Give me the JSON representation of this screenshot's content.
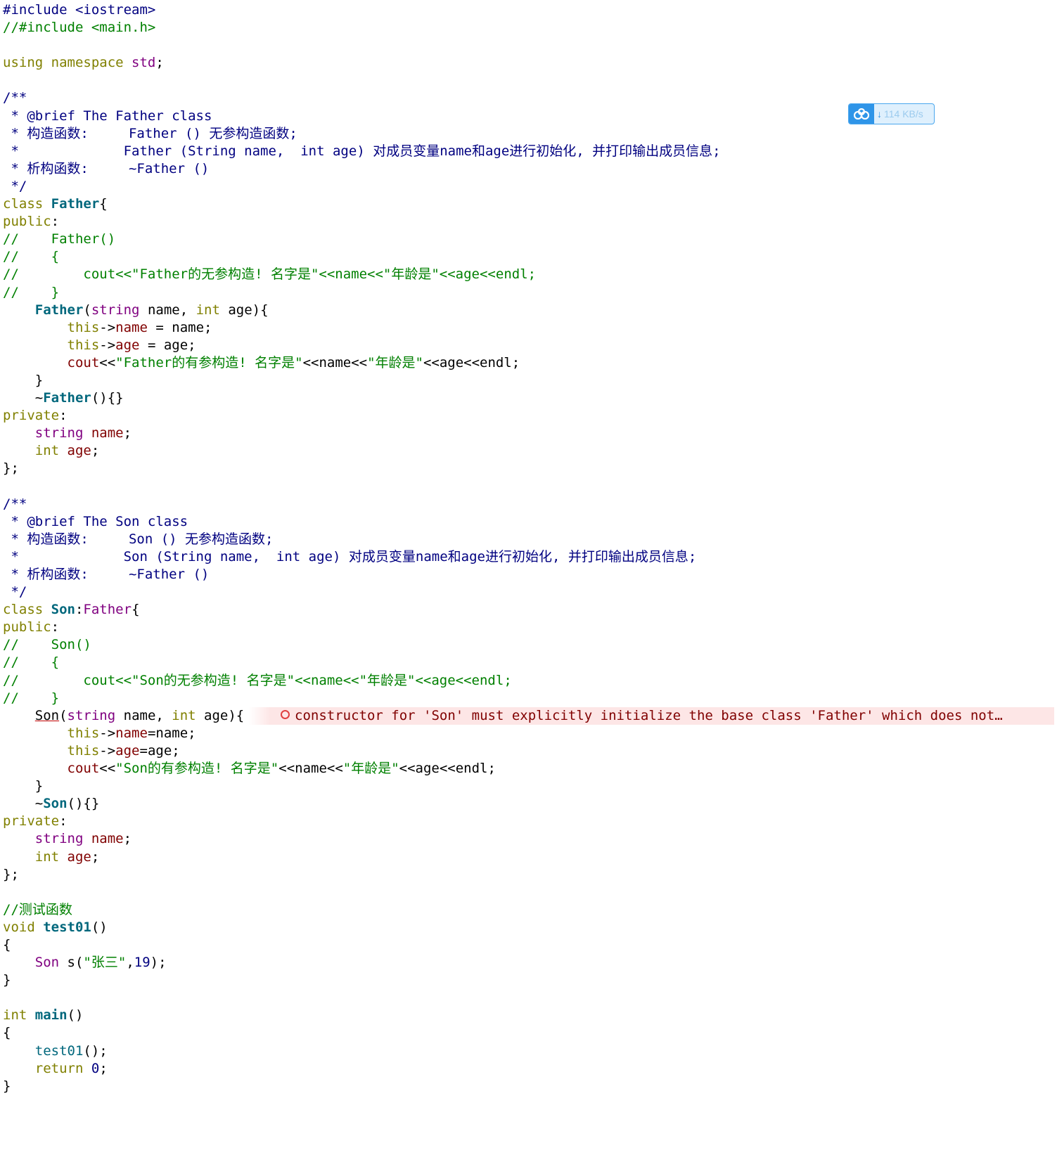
{
  "lines": [
    [
      [
        "pp",
        "#include <iostream>"
      ]
    ],
    [
      [
        "c",
        "//#include <main.h>"
      ]
    ],
    [],
    [
      [
        "k",
        "using namespace "
      ],
      [
        "pk",
        "std"
      ],
      [
        "p",
        ";"
      ]
    ],
    [],
    [
      [
        "d",
        "/**"
      ]
    ],
    [
      [
        "d",
        " * @brief The Father class"
      ]
    ],
    [
      [
        "d",
        " * 构造函数:     Father () 无参构造函数;"
      ]
    ],
    [
      [
        "d",
        " *             Father (String name,  int age) 对成员变量name和age进行初始化, 并打印输出成员信息;"
      ]
    ],
    [
      [
        "d",
        " * 析构函数:     ~Father ()"
      ]
    ],
    [
      [
        "d",
        " */"
      ]
    ],
    [
      [
        "k",
        "class "
      ],
      [
        "fb",
        "Father"
      ],
      [
        "p",
        "{"
      ]
    ],
    [
      [
        "k",
        "public"
      ],
      [
        "p",
        ":"
      ]
    ],
    [
      [
        "c",
        "//    Father()"
      ]
    ],
    [
      [
        "c",
        "//    {"
      ]
    ],
    [
      [
        "c",
        "//        cout<<\"Father的无参构造! 名字是\"<<name<<\"年龄是\"<<age<<endl;"
      ]
    ],
    [
      [
        "c",
        "//    }"
      ]
    ],
    [
      [
        "p",
        "    "
      ],
      [
        "fb",
        "Father"
      ],
      [
        "p",
        "("
      ],
      [
        "t",
        "string"
      ],
      [
        "p",
        " name, "
      ],
      [
        "k",
        "int"
      ],
      [
        "p",
        " age){"
      ]
    ],
    [
      [
        "p",
        "        "
      ],
      [
        "k",
        "this"
      ],
      [
        "p",
        "->"
      ],
      [
        "v",
        "name"
      ],
      [
        "p",
        " = name;"
      ]
    ],
    [
      [
        "p",
        "        "
      ],
      [
        "k",
        "this"
      ],
      [
        "p",
        "->"
      ],
      [
        "v",
        "age"
      ],
      [
        "p",
        " = age;"
      ]
    ],
    [
      [
        "p",
        "        "
      ],
      [
        "v",
        "cout"
      ],
      [
        "p",
        "<<"
      ],
      [
        "s",
        "\"Father的有参构造! 名字是\""
      ],
      [
        "p",
        "<<name<<"
      ],
      [
        "s",
        "\"年龄是\""
      ],
      [
        "p",
        "<<age<<endl;"
      ]
    ],
    [
      [
        "p",
        "    }"
      ]
    ],
    [
      [
        "p",
        "    ~"
      ],
      [
        "fb",
        "Father"
      ],
      [
        "p",
        "(){}"
      ]
    ],
    [
      [
        "k",
        "private"
      ],
      [
        "p",
        ":"
      ]
    ],
    [
      [
        "p",
        "    "
      ],
      [
        "t",
        "string"
      ],
      [
        "p",
        " "
      ],
      [
        "v",
        "name"
      ],
      [
        "p",
        ";"
      ]
    ],
    [
      [
        "p",
        "    "
      ],
      [
        "k",
        "int"
      ],
      [
        "p",
        " "
      ],
      [
        "v",
        "age"
      ],
      [
        "p",
        ";"
      ]
    ],
    [
      [
        "p",
        "};"
      ]
    ],
    [],
    [
      [
        "d",
        "/**"
      ]
    ],
    [
      [
        "d",
        " * @brief The Son class"
      ]
    ],
    [
      [
        "d",
        " * 构造函数:     Son () 无参构造函数;"
      ]
    ],
    [
      [
        "d",
        " *             Son (String name,  int age) 对成员变量name和age进行初始化, 并打印输出成员信息;"
      ]
    ],
    [
      [
        "d",
        " * 析构函数:     ~Father ()"
      ]
    ],
    [
      [
        "d",
        " */"
      ]
    ],
    [
      [
        "k",
        "class "
      ],
      [
        "fb",
        "Son"
      ],
      [
        "p",
        ":"
      ],
      [
        "t",
        "Father"
      ],
      [
        "p",
        "{"
      ]
    ],
    [
      [
        "k",
        "public"
      ],
      [
        "p",
        ":"
      ]
    ],
    [
      [
        "c",
        "//    Son()"
      ]
    ],
    [
      [
        "c",
        "//    {"
      ]
    ],
    [
      [
        "c",
        "//        cout<<\"Son的无参构造! 名字是\"<<name<<\"年龄是\"<<age<<endl;"
      ]
    ],
    [
      [
        "c",
        "//    }"
      ]
    ],
    [
      [
        "p",
        "    "
      ],
      [
        "e",
        "Son"
      ],
      [
        "p",
        "("
      ],
      [
        "t",
        "string"
      ],
      [
        "p",
        " name, "
      ],
      [
        "k",
        "int"
      ],
      [
        "p",
        " age){"
      ]
    ],
    [
      [
        "p",
        "        "
      ],
      [
        "k",
        "this"
      ],
      [
        "p",
        "->"
      ],
      [
        "v",
        "name"
      ],
      [
        "p",
        "=name;"
      ]
    ],
    [
      [
        "p",
        "        "
      ],
      [
        "k",
        "this"
      ],
      [
        "p",
        "->"
      ],
      [
        "v",
        "age"
      ],
      [
        "p",
        "=age;"
      ]
    ],
    [
      [
        "p",
        "        "
      ],
      [
        "v",
        "cout"
      ],
      [
        "p",
        "<<"
      ],
      [
        "s",
        "\"Son的有参构造! 名字是\""
      ],
      [
        "p",
        "<<name<<"
      ],
      [
        "s",
        "\"年龄是\""
      ],
      [
        "p",
        "<<age<<endl;"
      ]
    ],
    [
      [
        "p",
        "    }"
      ]
    ],
    [
      [
        "p",
        "    ~"
      ],
      [
        "fb",
        "Son"
      ],
      [
        "p",
        "(){}"
      ]
    ],
    [
      [
        "k",
        "private"
      ],
      [
        "p",
        ":"
      ]
    ],
    [
      [
        "p",
        "    "
      ],
      [
        "t",
        "string"
      ],
      [
        "p",
        " "
      ],
      [
        "v",
        "name"
      ],
      [
        "p",
        ";"
      ]
    ],
    [
      [
        "p",
        "    "
      ],
      [
        "k",
        "int"
      ],
      [
        "p",
        " "
      ],
      [
        "v",
        "age"
      ],
      [
        "p",
        ";"
      ]
    ],
    [
      [
        "p",
        "};"
      ]
    ],
    [],
    [
      [
        "c",
        "//测试函数"
      ]
    ],
    [
      [
        "k",
        "void "
      ],
      [
        "fb",
        "test01"
      ],
      [
        "p",
        "()"
      ]
    ],
    [
      [
        "p",
        "{"
      ]
    ],
    [
      [
        "p",
        "    "
      ],
      [
        "t",
        "Son"
      ],
      [
        "p",
        " s("
      ],
      [
        "s",
        "\"张三\""
      ],
      [
        "p",
        ","
      ],
      [
        "n",
        "19"
      ],
      [
        "p",
        ");"
      ]
    ],
    [
      [
        "p",
        "}"
      ]
    ],
    [],
    [
      [
        "k",
        "int "
      ],
      [
        "fb",
        "main"
      ],
      [
        "p",
        "()"
      ]
    ],
    [
      [
        "p",
        "{"
      ]
    ],
    [
      [
        "p",
        "    "
      ],
      [
        "f",
        "test01"
      ],
      [
        "p",
        "();"
      ]
    ],
    [
      [
        "p",
        "    "
      ],
      [
        "k",
        "return"
      ],
      [
        "p",
        " "
      ],
      [
        "n",
        "0"
      ],
      [
        "p",
        ";"
      ]
    ],
    [
      [
        "p",
        "}"
      ]
    ]
  ],
  "error": {
    "line_index": 40,
    "message": "constructor for 'Son' must explicitly initialize the base class 'Father' which does not…"
  },
  "speed_badge": {
    "text": "114 KB/s",
    "arrow": "↓"
  },
  "colors": {
    "keyword": "#808000",
    "comment": "#008000",
    "doc_comment": "#000080",
    "function": "#00677C",
    "member": "#800000",
    "type": "#800080",
    "error_bg": "#fde6e6"
  }
}
